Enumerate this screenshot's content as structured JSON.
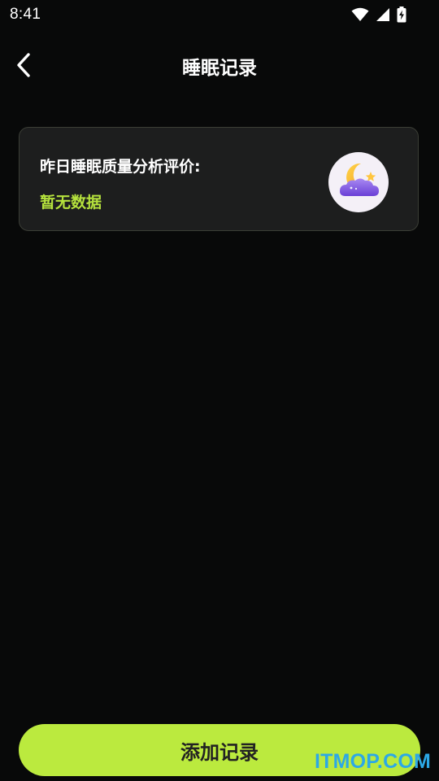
{
  "status_bar": {
    "time": "8:41",
    "icons": [
      "wifi-icon",
      "cellular-signal-icon",
      "battery-charging-icon"
    ]
  },
  "header": {
    "title": "睡眠记录",
    "back_icon": "chevron-left-icon"
  },
  "sleep_card": {
    "label": "昨日睡眠质量分析评价:",
    "value": "暂无数据",
    "icon": "moon-cloud-icon"
  },
  "footer": {
    "add_button_label": "添加记录"
  },
  "watermark": "ITMOP.COM",
  "colors": {
    "background": "#080909",
    "card_background": "#1d1e1e",
    "accent": "#bbea3e",
    "accent_text": "#b5e23d",
    "button_text": "#222222",
    "watermark": "#2ca8e6"
  }
}
